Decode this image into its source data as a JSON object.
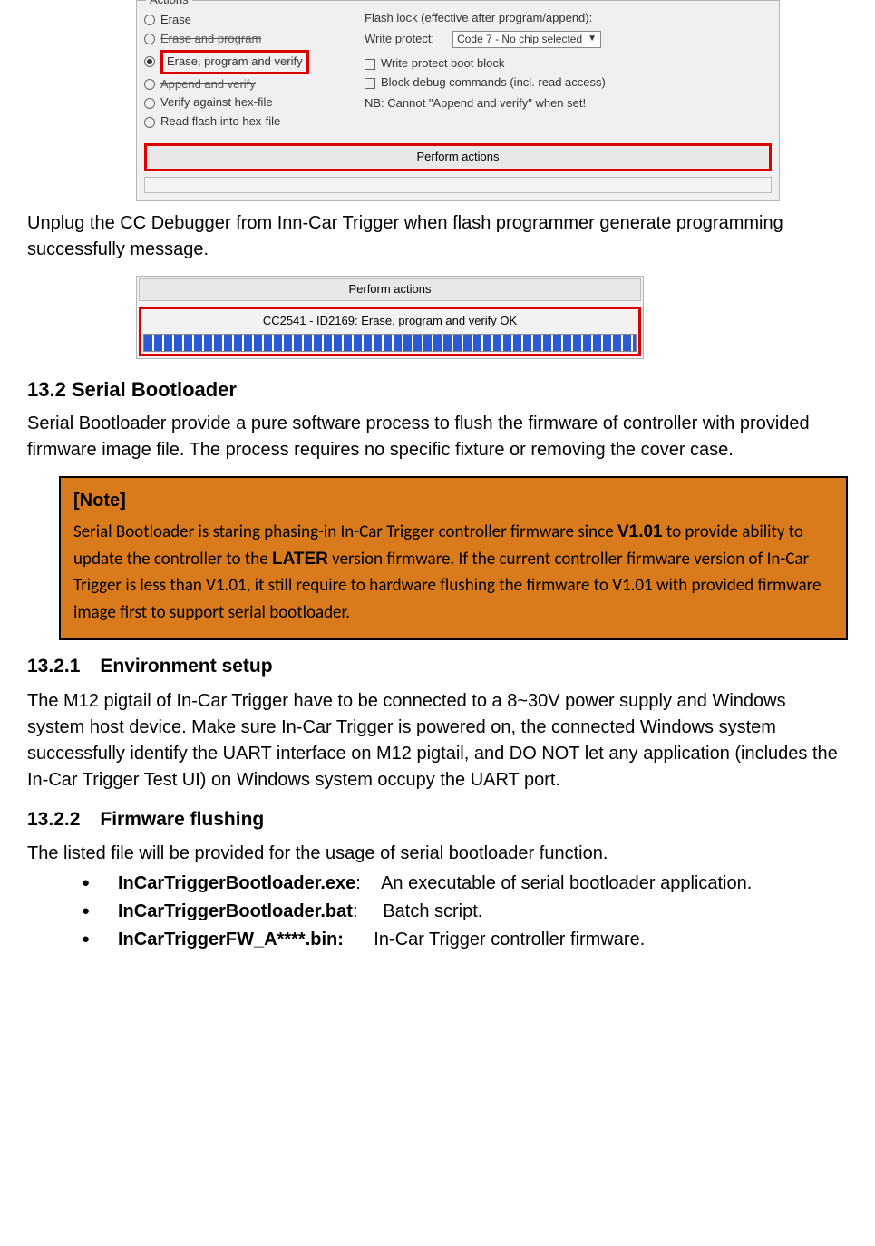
{
  "dialog1": {
    "group_title": "Actions",
    "radios": {
      "erase": "Erase",
      "erase_prog": "Erase and program",
      "erase_prog_verify": "Erase, program and verify",
      "append_verify": "Append and verify",
      "verify_hex": "Verify against hex-file",
      "read_hex": "Read flash into hex-file"
    },
    "right": {
      "flash_lock": "Flash lock (effective after program/append):",
      "write_protect_label": "Write protect:",
      "write_protect_value": "Code 7 - No chip selected",
      "wp_boot": "Write protect boot block",
      "block_debug": "Block debug commands (incl. read access)",
      "nb": "NB: Cannot \"Append and verify\" when set!"
    },
    "perform_button": "Perform actions"
  },
  "para1": "Unplug the CC Debugger from Inn-Car Trigger when flash programmer generate programming successfully message.",
  "dialog2": {
    "perform_button": "Perform actions",
    "status": "CC2541 - ID2169: Erase, program and verify OK"
  },
  "h2": {
    "num": "13.2",
    "title": "Serial Bootloader"
  },
  "para2": "Serial Bootloader provide a pure software process to flush the firmware of controller with provided firmware image file. The process requires no specific fixture or removing the cover case.",
  "note": {
    "title": "[Note]",
    "t1": "Serial Bootloader is staring phasing-in In-Car Trigger controller firmware since ",
    "v101": "V1.01",
    "t2": " to provide ability to update the controller to the ",
    "later": "LATER",
    "t3": " version firmware. If the current controller firmware version of In-Car Trigger is less than V1.01, it still require to hardware flushing the firmware to V1.01 with provided firmware image first to support serial bootloader."
  },
  "h3a": {
    "num": "13.2.1",
    "title": "Environment setup"
  },
  "para3": "The M12 pigtail of In-Car Trigger have to be connected to a 8~30V power supply and Windows system host device. Make sure In-Car Trigger is powered on, the connected Windows system successfully identify the UART interface on M12 pigtail, and DO NOT let any application (includes the In-Car Trigger Test UI) on Windows system occupy the UART port.",
  "h3b": {
    "num": "13.2.2",
    "title": "Firmware flushing"
  },
  "para4": "The listed file will be provided for the usage of serial bootloader function.",
  "files": [
    {
      "name": "InCarTriggerBootloader.exe",
      "colon": ":",
      "desc": "An executable of serial bootloader application."
    },
    {
      "name": "InCarTriggerBootloader.bat",
      "colon": ":",
      "desc": "Batch script."
    },
    {
      "name": "InCarTriggerFW_A****.bin",
      "colon": ":",
      "desc": "In-Car Trigger controller firmware."
    }
  ]
}
